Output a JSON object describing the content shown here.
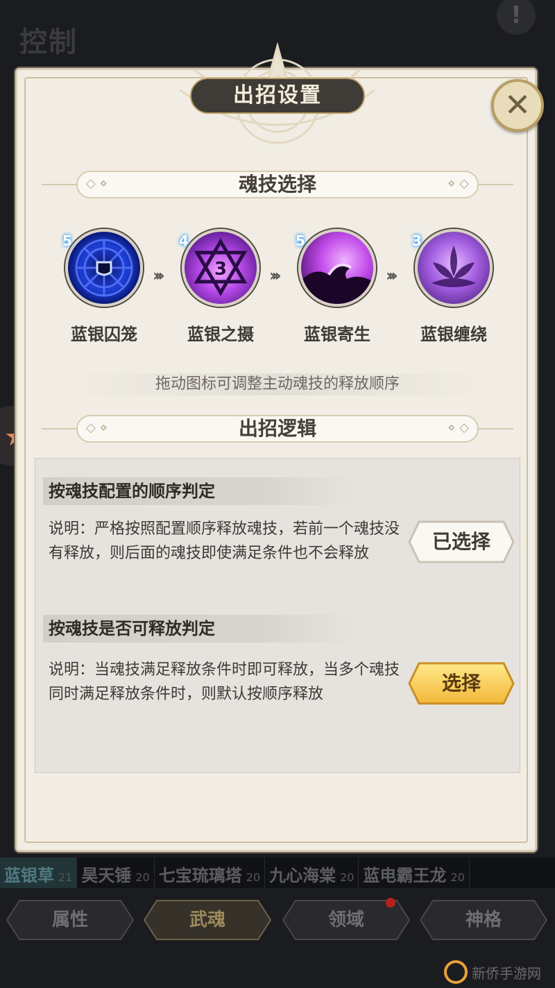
{
  "background": {
    "page_title": "控制",
    "alert_glyph": "!",
    "wuhun_list": [
      {
        "name": "蓝银草",
        "level": "21",
        "active": true
      },
      {
        "name": "昊天锤",
        "level": "20",
        "active": false
      },
      {
        "name": "七宝琉璃塔",
        "level": "20",
        "active": false
      },
      {
        "name": "九心海棠",
        "level": "20",
        "active": false
      },
      {
        "name": "蓝电霸王龙",
        "level": "20",
        "active": false
      }
    ],
    "tabs": [
      {
        "label": "属性",
        "active": false,
        "badge": false
      },
      {
        "label": "武魂",
        "active": true,
        "badge": false
      },
      {
        "label": "领域",
        "active": false,
        "badge": true
      },
      {
        "label": "神格",
        "active": false,
        "badge": false
      }
    ],
    "watermark": "新侨手游网"
  },
  "dialog": {
    "title": "出招设置",
    "close_glyph": "✕",
    "skill_section_title": "魂技选择",
    "skills": [
      {
        "name": "蓝银囚笼",
        "level": "5",
        "icon": "shield-cage-icon",
        "color": "#1f3fd0"
      },
      {
        "name": "蓝银之摄",
        "level": "4",
        "icon": "hexagram-icon",
        "color": "#a23ad9"
      },
      {
        "name": "蓝银寄生",
        "level": "5",
        "icon": "wave-icon",
        "color": "#b03ee0"
      },
      {
        "name": "蓝银缠绕",
        "level": "3",
        "icon": "lotus-icon",
        "color": "#9a4ad8"
      }
    ],
    "drag_hint": "拖动图标可调整主动魂技的释放顺序",
    "logic_section_title": "出招逻辑",
    "options": [
      {
        "title": "按魂技配置的顺序判定",
        "desc": "说明：严格按照配置顺序释放魂技，若前一个魂技没有释放，则后面的魂技即使满足条件也不会释放",
        "button": "已选择",
        "selected": true
      },
      {
        "title": "按魂技是否可释放判定",
        "desc": "说明：当魂技满足释放条件时即可释放，当多个魂技同时满足释放条件时，则默认按顺序释放",
        "button": "选择",
        "selected": false
      }
    ]
  }
}
